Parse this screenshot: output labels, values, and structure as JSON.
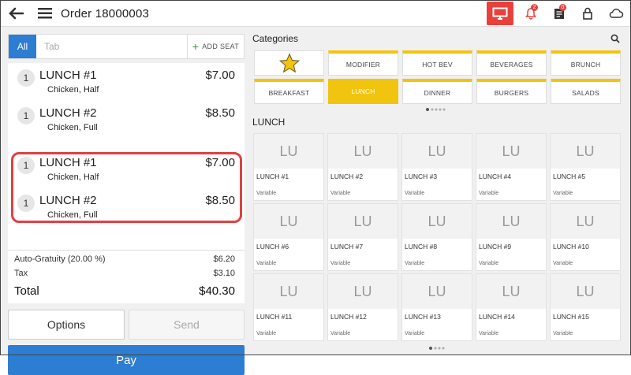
{
  "header": {
    "title": "Order 18000003",
    "notifications_count": "2",
    "orders_count": "0"
  },
  "tabs": {
    "all": "All",
    "tab": "Tab",
    "add_seat": "ADD SEAT"
  },
  "order_items": [
    {
      "seat": "1",
      "name": "LUNCH #1",
      "price": "$7.00",
      "modifier": "Chicken, Half"
    },
    {
      "seat": "1",
      "name": "LUNCH #2",
      "price": "$8.50",
      "modifier": "Chicken, Full"
    },
    {
      "seat": "1",
      "name": "LUNCH #1",
      "price": "$7.00",
      "modifier": "Chicken, Half"
    },
    {
      "seat": "1",
      "name": "LUNCH #2",
      "price": "$8.50",
      "modifier": "Chicken, Full"
    }
  ],
  "totals": {
    "gratuity_label": "Auto-Gratuity (20.00 %)",
    "gratuity_value": "$6.20",
    "tax_label": "Tax",
    "tax_value": "$3.10",
    "total_label": "Total",
    "total_value": "$40.30"
  },
  "buttons": {
    "options": "Options",
    "send": "Send",
    "pay": "Pay"
  },
  "categories_header": "Categories",
  "categories": [
    "",
    "MODIFIER",
    "HOT BEV",
    "BEVERAGES",
    "BRUNCH",
    "BREAKFAST",
    "LUNCH",
    "DINNER",
    "BURGERS",
    "SALADS"
  ],
  "selected_category": "LUNCH",
  "products_header": "LUNCH",
  "product_placeholder": "LU",
  "product_variant": "Variable",
  "products": [
    "LUNCH #1",
    "LUNCH #2",
    "LUNCH #3",
    "LUNCH #4",
    "LUNCH #5",
    "LUNCH #6",
    "LUNCH #7",
    "LUNCH #8",
    "LUNCH #9",
    "LUNCH #10",
    "LUNCH #11",
    "LUNCH #12",
    "LUNCH #13",
    "LUNCH #14",
    "LUNCH #15"
  ],
  "colors": {
    "accent_blue": "#2d7dd2",
    "accent_yellow": "#f1c40f",
    "alert_red": "#e8413c"
  }
}
